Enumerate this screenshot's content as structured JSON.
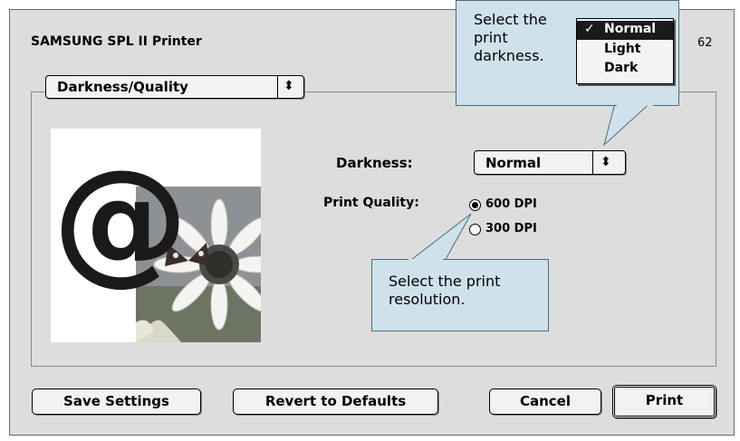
{
  "dialog": {
    "title": "SAMSUNG SPL II Printer",
    "version": "62",
    "panel_select": "Darkness/Quality",
    "darkness_label": "Darkness:",
    "darkness_value": "Normal",
    "print_quality_label": "Print Quality:",
    "quality_options": [
      {
        "label": "600 DPI",
        "selected": true
      },
      {
        "label": "300 DPI",
        "selected": false
      }
    ],
    "buttons": {
      "save": "Save Settings",
      "revert": "Revert to Defaults",
      "cancel": "Cancel",
      "print": "Print"
    }
  },
  "darkness_menu": {
    "items": [
      {
        "label": "Normal",
        "checked": true
      },
      {
        "label": "Light",
        "checked": false
      },
      {
        "label": "Dark",
        "checked": false
      }
    ]
  },
  "callouts": {
    "darkness": "Select the print darkness.",
    "resolution": "Select the print resolution."
  },
  "colors": {
    "dialog_bg": "#dddddd",
    "callout_bg": "#cfe1ea",
    "menu_selected": "#1a1a1a"
  }
}
